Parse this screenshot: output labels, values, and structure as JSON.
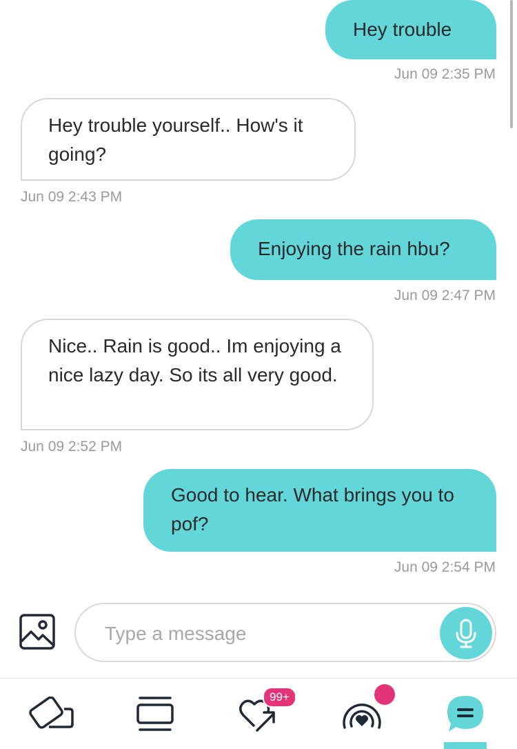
{
  "messages": [
    {
      "from": "me",
      "text": "Hey trouble",
      "time": "Jun 09 2:35 PM"
    },
    {
      "from": "them",
      "text": "Hey trouble yourself.. How's it going?",
      "time": "Jun 09 2:43 PM"
    },
    {
      "from": "me",
      "text": "Enjoying the rain hbu?",
      "time": "Jun 09 2:47 PM"
    },
    {
      "from": "them",
      "text": "Nice.. Rain is good.. Im enjoying a nice lazy day. So its all very good.",
      "time": "Jun 09 2:52 PM"
    },
    {
      "from": "me",
      "text": "Good to hear. What brings you to pof?",
      "time": "Jun 09 2:54 PM"
    }
  ],
  "composer": {
    "placeholder": "Type a message",
    "attach_icon": "image-icon",
    "mic_icon": "microphone-icon"
  },
  "nav": {
    "items": [
      {
        "icon": "cards-icon"
      },
      {
        "icon": "feed-icon"
      },
      {
        "icon": "heart-arrow-icon",
        "badge": "99+"
      },
      {
        "icon": "live-heart-icon",
        "dot": true
      },
      {
        "icon": "chat-icon",
        "active": true
      }
    ]
  },
  "colors": {
    "accent": "#62d6d9",
    "badge": "#e3347a",
    "icon": "#1f2a36"
  }
}
